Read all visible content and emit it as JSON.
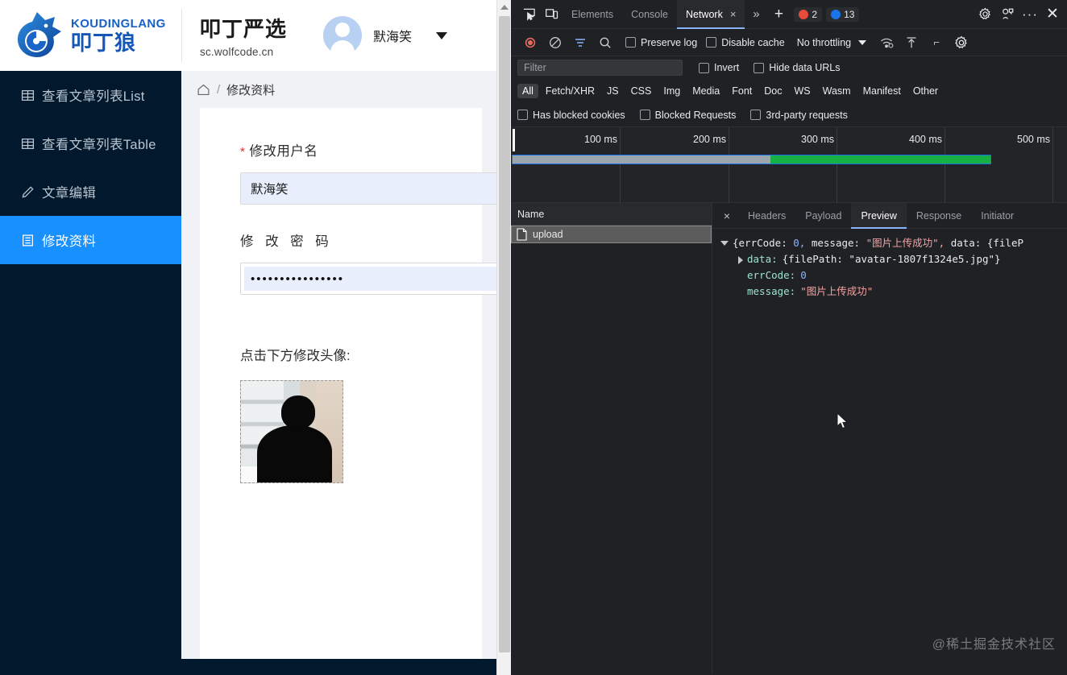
{
  "webapp": {
    "logo": {
      "en": "KOUDINGLANG",
      "cn": "叩丁狼",
      "icon": "wolf-logo-icon"
    },
    "brand": {
      "name": "叩丁严选",
      "url": "sc.wolfcode.cn"
    },
    "user": {
      "name": "默海笑",
      "avatar_icon": "user-avatar-icon",
      "caret_icon": "chevron-down-icon"
    },
    "sidebar": {
      "items": [
        {
          "label": "查看文章列表List",
          "icon": "table-icon",
          "active": false
        },
        {
          "label": "查看文章列表Table",
          "icon": "table-icon",
          "active": false
        },
        {
          "label": "文章编辑",
          "icon": "pencil-icon",
          "active": false
        },
        {
          "label": "修改资料",
          "icon": "list-icon",
          "active": true
        }
      ],
      "active_color": "#1890ff"
    },
    "breadcrumb": {
      "home_icon": "home-icon",
      "separator": "/",
      "current": "修改资料"
    },
    "form": {
      "username": {
        "required_mark": "*",
        "label": "修改用户名",
        "value": "默海笑"
      },
      "password": {
        "label": "修 改 密 码",
        "value": "••••••••••••••••"
      },
      "avatar": {
        "hint": "点击下方修改头像:",
        "image_alt": "user-avatar-photo"
      }
    }
  },
  "devtools": {
    "topbar": {
      "inspect_icon": "inspect-element-icon",
      "device_icon": "device-toolbar-icon",
      "tabs": [
        {
          "label": "Elements",
          "active": false
        },
        {
          "label": "Console",
          "active": false
        },
        {
          "label": "Network",
          "active": true,
          "closable": "×"
        }
      ],
      "more_tabs": "»",
      "add_tab": "+",
      "errors": {
        "count": "2",
        "color": "#e64b3b"
      },
      "info": {
        "count": "13",
        "color": "#1a73e8"
      },
      "settings_icon": "gear-icon",
      "customize_icon": "devtools-settings-icon",
      "more_icon": "more-options-icon",
      "close_icon": "close-icon"
    },
    "toolbar": {
      "record_icon": "record-stop-icon",
      "clear_icon": "clear-icon",
      "filter_icon": "filter-icon",
      "search_icon": "search-icon",
      "preserve_log": {
        "label": "Preserve log",
        "checked": false
      },
      "disable_cache": {
        "label": "Disable cache",
        "checked": false
      },
      "throttling": {
        "value": "No throttling",
        "caret": "▼"
      },
      "wifi_icon": "network-conditions-icon",
      "import_icon": "import-har-icon",
      "export_icon": "export-har-icon",
      "network_settings_icon": "gear-icon"
    },
    "filterbar": {
      "placeholder": "Filter",
      "invert": {
        "label": "Invert",
        "checked": false
      },
      "hide_data_urls": {
        "label": "Hide data URLs",
        "checked": false
      }
    },
    "types": [
      {
        "label": "All",
        "selected": true
      },
      {
        "label": "Fetch/XHR",
        "selected": false
      },
      {
        "label": "JS",
        "selected": false
      },
      {
        "label": "CSS",
        "selected": false
      },
      {
        "label": "Img",
        "selected": false
      },
      {
        "label": "Media",
        "selected": false
      },
      {
        "label": "Font",
        "selected": false
      },
      {
        "label": "Doc",
        "selected": false
      },
      {
        "label": "WS",
        "selected": false
      },
      {
        "label": "Wasm",
        "selected": false
      },
      {
        "label": "Manifest",
        "selected": false
      },
      {
        "label": "Other",
        "selected": false
      }
    ],
    "thirdbar": {
      "has_blocked_cookies": {
        "label": "Has blocked cookies",
        "checked": false
      },
      "blocked_requests": {
        "label": "Blocked Requests",
        "checked": false
      },
      "third_party": {
        "label": "3rd-party requests",
        "checked": false
      }
    },
    "overview": {
      "ticks": [
        "100 ms",
        "200 ms",
        "300 ms",
        "400 ms",
        "500 ms"
      ],
      "bar_colors": {
        "waiting": "#9aa5ad",
        "download": "#17b045",
        "border": "#1a73e8"
      }
    },
    "requests": {
      "column_header": "Name",
      "rows": [
        {
          "name": "upload",
          "icon": "document-icon",
          "selected": true
        }
      ]
    },
    "detail": {
      "close_icon": "×",
      "tabs": [
        {
          "label": "Headers",
          "active": false
        },
        {
          "label": "Payload",
          "active": false
        },
        {
          "label": "Preview",
          "active": true
        },
        {
          "label": "Response",
          "active": false
        },
        {
          "label": "Initiator",
          "active": false
        }
      ],
      "preview": {
        "root_line": {
          "open": "{",
          "k1": "errCode:",
          "v1": " 0,",
          "k2": " message:",
          "v2": " \"图片上传成功\",",
          "k3": " data:",
          "v3": " {fileP"
        },
        "children": [
          {
            "key": "data:",
            "value": "{filePath: \"avatar-1807f1324e5.jpg\"}",
            "expandable": true
          },
          {
            "key": "errCode:",
            "value": "0",
            "type": "number"
          },
          {
            "key": "message:",
            "value": "\"图片上传成功\"",
            "type": "string"
          }
        ]
      }
    },
    "watermark": "@稀土掘金技术社区"
  }
}
